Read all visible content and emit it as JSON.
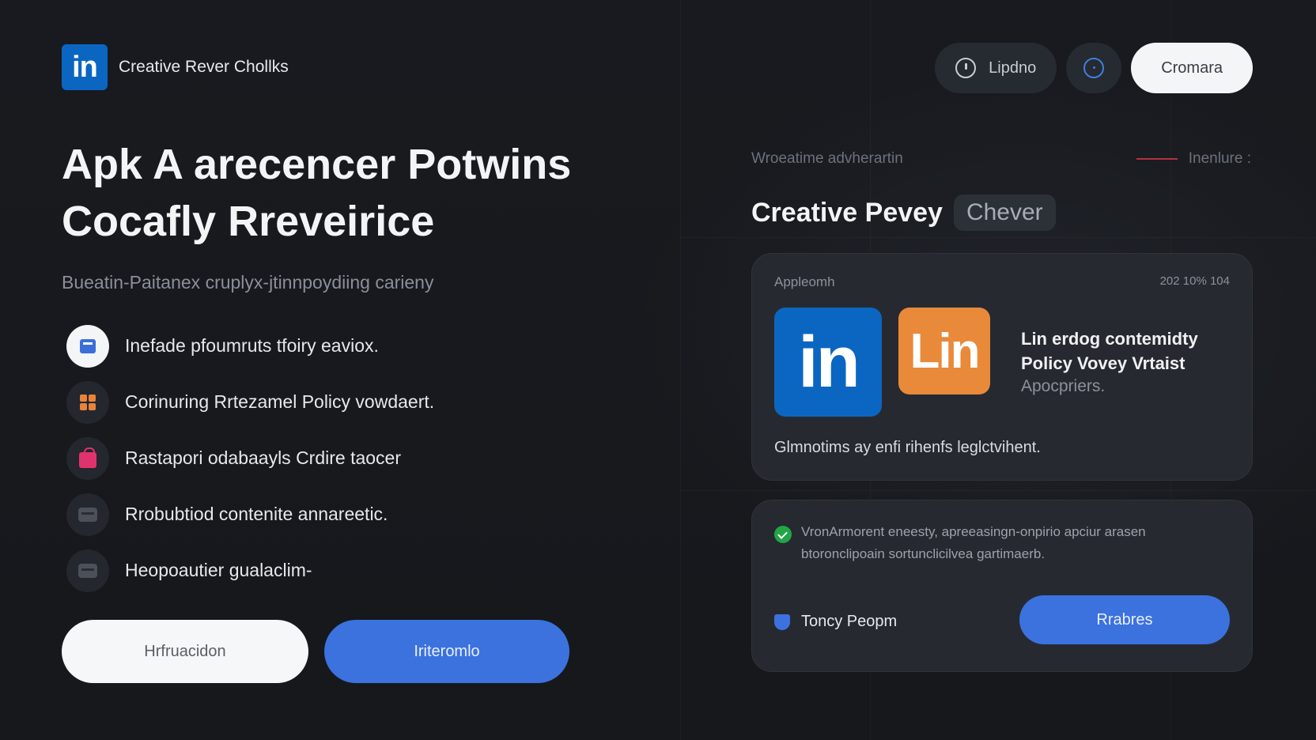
{
  "header": {
    "brand_logo": "in",
    "brand_name": "Creative Rever Chollks",
    "pill_label": "Lipdno",
    "cta_label": "Cromara"
  },
  "hero": {
    "title": "Apk A arecencer Potwins Cocafly Rreveirice",
    "subtitle": "Bueatin-Paitanex cruplyx-jtinnpoydiing carieny"
  },
  "features": [
    {
      "icon": "document-icon",
      "text": "Inefade pfoumruts tfoiry eaviox."
    },
    {
      "icon": "grid-icon",
      "text": "Corinuring Rrtezamel Policy vowdaert."
    },
    {
      "icon": "bag-icon",
      "text": "Rastapori odabaayls Crdire taocer"
    },
    {
      "icon": "card-icon",
      "text": "Rrobubtiod contenite annareetic."
    },
    {
      "icon": "card-icon",
      "text": "Heopoautier gualaclim-"
    }
  ],
  "buttons": {
    "secondary": "Hrfruacidon",
    "primary": "Iriteromlo"
  },
  "right": {
    "kicker": "Wroeatime advherartin",
    "kicker_right": "Inenlure :",
    "title": "Creative Pevey",
    "chip": "Chever",
    "card1": {
      "label": "Appleomh",
      "date": "202 10%  104",
      "logo_big": "in",
      "logo_orange": "Lin",
      "heading": "Lin erdog contemidty Policy Vovey Vrtaist",
      "sub": "Apocpriers.",
      "foot": "Glmnotims ay enfi rihenfs leglctvihent."
    },
    "card2": {
      "text": "VronArmorent eneesty, apreeasingn-onpirio apciur arasen btoronclipoain sortunclicilvea gartimaerb.",
      "user": "Toncy Peopm",
      "button": "Rrabres"
    }
  },
  "colors": {
    "background": "#17191e",
    "linkedin_blue": "#0b66c2",
    "accent_blue": "#3b72de",
    "orange": "#e88a3a",
    "pink": "#e0336e",
    "green": "#22a447"
  }
}
